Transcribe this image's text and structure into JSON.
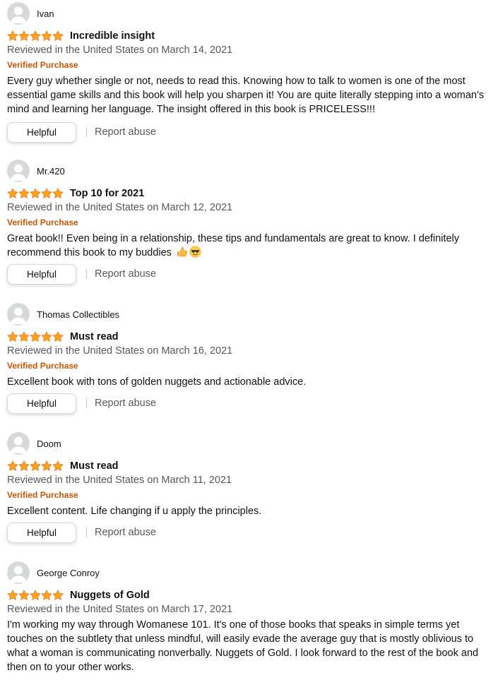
{
  "theme": {
    "star_color": "#ffa41c",
    "star_stroke": "#de7921",
    "verified_color": "#c45500",
    "secondary_text": "#565959"
  },
  "reviews": [
    {
      "profile_name": "Ivan",
      "rating": 5,
      "title": "Incredible insight",
      "date": "Reviewed in the United States on March 14, 2021",
      "verified": "Verified Purchase",
      "body": "Every guy whether single or not, needs to read this. Knowing how to talk to women is one of the most essential game skills and this book will help you sharpen it! You are quite literally stepping into a woman’s mind and learning her language. The insight offered in this book is PRICELESS!!!",
      "helpful_label": "Helpful",
      "report_label": "Report abuse"
    },
    {
      "profile_name": "Mr.420",
      "rating": 5,
      "title": "Top 10 for 2021",
      "date": "Reviewed in the United States on March 12, 2021",
      "verified": "Verified Purchase",
      "body": "Great book!! Even being in a relationship, these tips and fundamentals are great to know. I definitely recommend this book to my buddies",
      "emojis": [
        "thumbs-up-icon",
        "sunglasses-face-icon"
      ],
      "helpful_label": "Helpful",
      "report_label": "Report abuse"
    },
    {
      "profile_name": "Thomas Collectibles",
      "rating": 5,
      "title": "Must read",
      "date": "Reviewed in the United States on March 16, 2021",
      "verified": "Verified Purchase",
      "body": "Excellent book with tons of golden nuggets and actionable advice.",
      "helpful_label": "Helpful",
      "report_label": "Report abuse"
    },
    {
      "profile_name": "Doom",
      "rating": 5,
      "title": "Must read",
      "date": "Reviewed in the United States on March 11, 2021",
      "verified": "Verified Purchase",
      "body": "Excellent content. Life changing if u apply the principles.",
      "helpful_label": "Helpful",
      "report_label": "Report abuse"
    },
    {
      "profile_name": "George Conroy",
      "rating": 5,
      "title": "Nuggets of Gold",
      "date": "Reviewed in the United States on March 17, 2021",
      "body": "I'm working my way through Womanese 101. It's one of those books that speaks in simple terms yet touches on the subtlety that unless mindful, will easily evade the average guy that is mostly oblivious to what a woman is communicating nonverbally. Nuggets of Gold. I look forward to the rest of the book and then on to your other works."
    }
  ]
}
